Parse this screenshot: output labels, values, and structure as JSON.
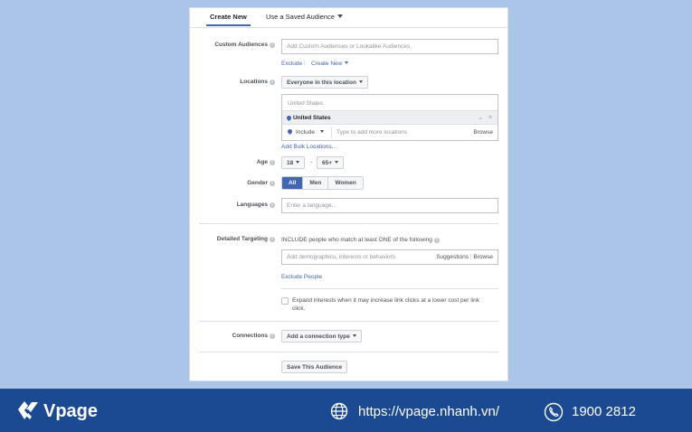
{
  "tabs": {
    "create_new": "Create New",
    "saved_audience": "Use a Saved Audience"
  },
  "custom_audiences": {
    "label": "Custom Audiences",
    "placeholder": "Add Custom Audiences or Lookalike Audiences",
    "exclude": "Exclude",
    "create_new": "Create New"
  },
  "locations": {
    "label": "Locations",
    "dropdown": "Everyone in this location",
    "country_header": "United States",
    "selected": "United States",
    "include": "Include",
    "placeholder": "Type to add more locations",
    "browse": "Browse",
    "bulk_link": "Add Bulk Locations..."
  },
  "age": {
    "label": "Age",
    "min": "18",
    "separator": "-",
    "max": "65+"
  },
  "gender": {
    "label": "Gender",
    "options": [
      "All",
      "Men",
      "Women"
    ]
  },
  "languages": {
    "label": "Languages",
    "placeholder": "Enter a language..."
  },
  "detailed_targeting": {
    "label": "Detailed Targeting",
    "include_text": "INCLUDE people who match at least ONE of the following",
    "placeholder": "Add demographics, interests or behaviors",
    "suggestions": "Suggestions",
    "separator": "|",
    "browse": "Browse",
    "exclude_link": "Exclude People",
    "expand_text_1": "Expand interests when it may increase link clicks at a lower cost per link",
    "expand_text_2": "click."
  },
  "connections": {
    "label": "Connections",
    "dropdown": "Add a connection type"
  },
  "save_button": "Save This Audience",
  "footer": {
    "brand": "Vpage",
    "url": "https://vpage.nhanh.vn/",
    "phone": "1900 2812"
  },
  "colors": {
    "accent": "#4267b2",
    "footer_bg": "#1b4a92",
    "page_bg": "#aac5e8"
  }
}
